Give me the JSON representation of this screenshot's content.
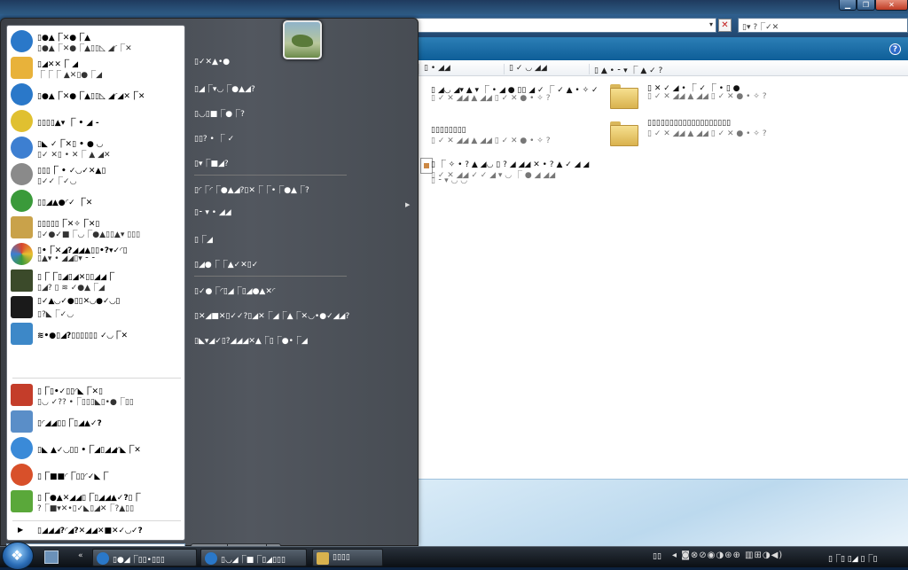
{
  "window": {
    "buttons": {
      "minimize": "▁",
      "maximize": "❐",
      "close": "✕"
    },
    "address": {
      "value": "",
      "cancel_symbol": "✕",
      "dropdown_symbol": "▾"
    },
    "search": {
      "placeholder": "▯▾ ?⎾✓✕"
    },
    "help_symbol": "?",
    "column_headers": [
      "▯ • ◢◢",
      "▯ ✓ ◡ ◢◢",
      "▯ ▲ • ⁃ ▾ ⎾ ▲ ✓ ?"
    ],
    "files": [
      {
        "name": "▯ ◢◡ ◢▾ ▲ ▾ ⎾ • ◢ ● ▯▯ ◢ ✓ ⎾ ✓ ▲ • ✧ ✓",
        "sub": "▯ ✓ ✕ ◢◢ ▲ ◢◢ ▯ ✓ ✕ ● • ✧ ?",
        "icon": "folder-icon"
      },
      {
        "name": "▯ ✕ ✓ ◢ • ⎾ ✓ ⎾ • ▯ ●",
        "sub": "▯ ✓ ✕ ◢◢ ▲ ◢◢ ▯ ✓ ✕ ● • ✧ ?",
        "icon": "folder-icon"
      },
      {
        "name": "▯▯▯▯▯▯▯▯",
        "sub": "▯ ✓ ✕ ◢◢ ▲ ◢◢ ▯ ✓ ✕ ● • ✧ ?",
        "icon": "folder-icon"
      },
      {
        "name": "▯▯▯▯▯▯▯▯▯▯▯▯▯▯▯▯▯▯▯",
        "sub": "▯ ✓ ✕ ◢◢ ▲ ◢◢ ▯ ✓ ✕ ● • ✧ ?",
        "icon": "folder-icon"
      },
      {
        "name": "▯ ⎾ ✧ • ? ▲ ◢◡ ▯ ? ◢ ◢◢ ✕ • ? ▲ ✓ ◢ ◢",
        "sub": "▯ ✓ ✕ ◢◢ ✓ ✓ ◢ ▾ ◡ ⎾ ● ◢ ◢◢",
        "extra": "▯ ⁃ ▾ ◡ ◡",
        "icon": "doc-icon"
      }
    ]
  },
  "start_menu": {
    "pinned": [
      {
        "title": "▯●▲⎾✕●⎾▲",
        "sub": "▯●▲⎾✕●⎾▲▯▯◺ ◢◜⎾✕",
        "icon": "internet-explorer-icon",
        "color": "#2a78c9"
      },
      {
        "title": "▯◢✕✕⎾ ◢",
        "sub": "⎾⎾⎾ ▲✕▯●⎾◢",
        "icon": "mail-envelope-icon",
        "color": "#e8b23a"
      }
    ],
    "recent": [
      {
        "title": "▯●▲⎾✕●⎾▲▯▯◺ ◢◜◢✕⎾✕",
        "sub": "",
        "icon": "internet-explorer-icon",
        "color": "#2a78c9"
      },
      {
        "title": "▯▯▯▯▲▾ ⎾ • ◢ ⁃",
        "sub": "",
        "icon": "norton-shield-icon",
        "color": "#e0c030"
      },
      {
        "title": "▯◣ ✓⎾✕▯ • ● ◡",
        "sub": "▯✓ ✕▯ • ✕⎾ ▲ ◢✕",
        "icon": "messenger-icon",
        "color": "#3d7fd1"
      },
      {
        "title": "▯▯▯⎾ • ✓◡✓✕▲▯",
        "sub": "▯✓✓⎾✓◡",
        "icon": "webcam-icon",
        "color": "#8a8a8a"
      },
      {
        "title": "▯▯◢▲●◜✓ ⎾✕",
        "sub": "",
        "icon": "globe-icon",
        "color": "#3a9a3a"
      },
      {
        "title": "▯▯▯▯▯⎾✕✧⎾✕▯",
        "sub": "▯✓●✓■⎾◡⎾●▲▯▯▲▾ ▯▯▯",
        "icon": "tools-icon",
        "color": "#c9a24a"
      },
      {
        "title": "▯•⎾✕◢?◢◢▲▯▯•?▾✓◜▯",
        "sub": "▯▲▾ • ◢◢▯▾ ⁃ ⁃",
        "icon": "color-palette-icon",
        "color": "#d8452f"
      },
      {
        "title": "▯⎾⎾▯◢▯◢✕▯▯◢◢⎾",
        "sub": "▯◢? ▯ ≋ ✓●▲⎾◢",
        "icon": "mw-game-icon",
        "color": "#3b4a2a"
      },
      {
        "title": "▯✓▲◡✓●▯▯✕◡●✓◡▯",
        "sub": "▯?◣⎾✓◡",
        "icon": "crescent-moon-icon",
        "color": "#1a1a1a"
      },
      {
        "title": "≋•●▯◢?▯▯▯▯▯▯ ✓◡⎾✕",
        "sub": "",
        "icon": "disc-burner-icon",
        "color": "#3d88c8"
      },
      {
        "title": "▯⎾▯•✓▯▯◜◣⎾✕▯",
        "sub": "▯◡ ✓?? •⎾▯▯▯◣▯•●⎾▯▯",
        "icon": "counter-321-icon",
        "color": "#c43d2a"
      },
      {
        "title": "▯◜◢◢▯▯⎾▯◢▲✓?",
        "sub": "",
        "icon": "document-icon",
        "color": "#5a8ec8"
      },
      {
        "title": "▯◣ ▲✓◡▯▯ •⎾◢▯◢◢◜◣⎾✕",
        "sub": "",
        "icon": "media-player-icon",
        "color": "#3a8ad8"
      },
      {
        "title": "▯⎾■■◜⎾▯▯◜✓◣⎾",
        "sub": "",
        "icon": "powerpoint-icon",
        "color": "#d8502a"
      },
      {
        "title": "▯⎾●▲✕◢◢▯⎾▯◢◢▲✓?▯⎾",
        "sub": "?⎾■▾✕•▯✓◣▯◢✕⎾?▲▯▯",
        "icon": "installer-icon",
        "color": "#5aa83a"
      }
    ],
    "all_programs": {
      "arrow": "▶",
      "label": "▯◢◢◢?◜◢?✕◢◢✕■✕✓◡✓?"
    },
    "search_placeholder": "▯●•⎾•✓✕▯✓▯? ⁃ ▾⎾◡✓",
    "search_icon": "⚲",
    "right_links": [
      {
        "label": "▯✓✕▲•●",
        "icon": "user-folder-icon"
      },
      {
        "label": "▯◢⎾▾◡⎾●▲◢?",
        "icon": "documents-icon"
      },
      {
        "label": "▯◡▯■⎾●⎾?",
        "icon": "pictures-icon"
      },
      {
        "label": "▯▯? • ⎾ ✓",
        "icon": "music-icon"
      },
      {
        "label": "▯▾⎾■◢?",
        "icon": "games-icon"
      },
      {
        "label": "▯◜⎾◜⎾●▲◢?▯✕⎾⎾•⎾●▲⎾?",
        "icon": "recent-items-icon",
        "has_submenu": true
      },
      {
        "label": "▯⁃ ▾ • ◢◢",
        "icon": "computer-icon"
      },
      {
        "label": "▯⎾◢",
        "icon": "network-icon"
      },
      {
        "label": "▯◢●⎾⎾▲✓✕▯✓",
        "icon": "connect-to-icon"
      },
      {
        "label": "▯✓●⎾◜▯◢⎾▯◢●▲✕◜",
        "icon": "control-panel-icon"
      },
      {
        "label": "▯✕◢■✕▯✓✓?▯◢✕⎾◢⎾▲⎾✕◡•●✓◢◢?",
        "icon": "default-programs-icon"
      },
      {
        "label": "▯◣▾◢✓▯?◢◢◢✕▲⎾▯⎾●•⎾◢",
        "icon": "help-support-icon"
      }
    ],
    "power": {
      "power_symbol": "⏻",
      "lock_symbol": "🔒",
      "arrow_symbol": "▸"
    }
  },
  "taskbar": {
    "ql_chevron": "«",
    "tasks": [
      {
        "label": "▯●◢⎾▯▯•▯▯▯",
        "icon": "internet-explorer-icon",
        "color": "#2a78c9"
      },
      {
        "label": "▯◡◢⎾■⎾▯◢▯▯▯",
        "icon": "internet-explorer-icon",
        "color": "#2a78c9"
      },
      {
        "label": "▯▯▯▯",
        "icon": "folder-icon",
        "color": "#d9b24e"
      }
    ],
    "language": "▯▯",
    "tray": "◂ ◙⊗⊘◉◑⊛⊕ ▥⊞◑◀)",
    "clock": "▯⎾▯ ▯◢ ▯⎾▯"
  }
}
